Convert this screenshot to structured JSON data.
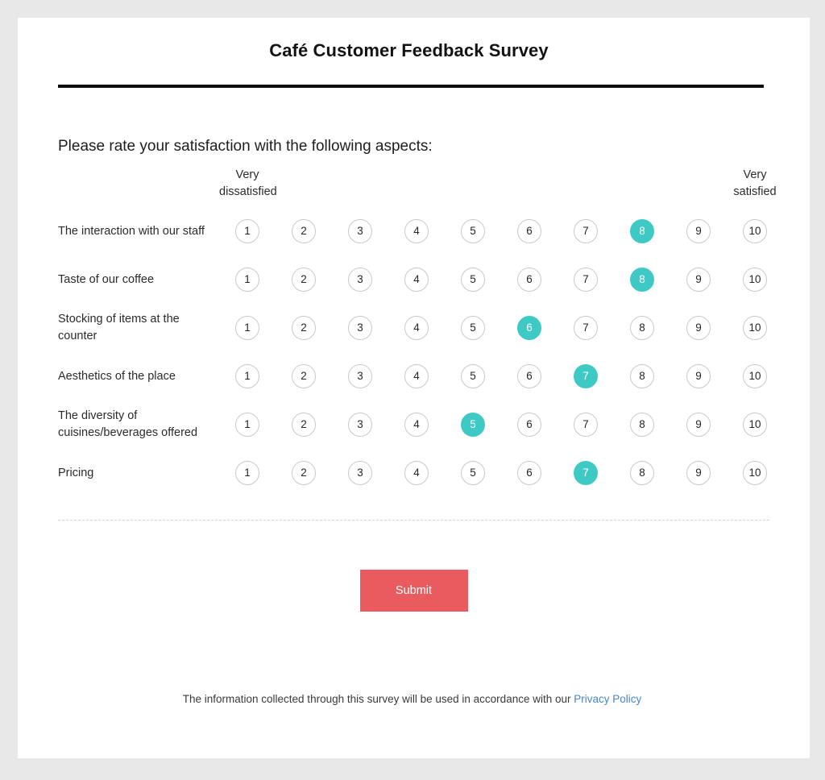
{
  "survey": {
    "title": "Café Customer Feedback Survey",
    "prompt": "Please rate your satisfaction with the following aspects:",
    "anchors": {
      "low_line1": "Very",
      "low_line2": "dissatisfied",
      "high_line1": "Very",
      "high_line2": "satisfied"
    },
    "scale": [
      "1",
      "2",
      "3",
      "4",
      "5",
      "6",
      "7",
      "8",
      "9",
      "10"
    ],
    "rows": [
      {
        "label": "The interaction with our staff",
        "selected": 8
      },
      {
        "label": "Taste of our coffee",
        "selected": 8
      },
      {
        "label": "Stocking of items at the counter",
        "selected": 6
      },
      {
        "label": "Aesthetics of the place",
        "selected": 7
      },
      {
        "label": "The diversity of cuisines/beverages offered",
        "selected": 5
      },
      {
        "label": "Pricing",
        "selected": 7
      }
    ],
    "submit_label": "Submit",
    "footer": {
      "text": "The information collected through this survey will be used in accordance with our ",
      "link_label": "Privacy Policy"
    },
    "colors": {
      "selected": "#3fc9c5",
      "submit": "#ea5b60",
      "link": "#4a86c8",
      "page_background": "#e8e8e8",
      "card_background": "#ffffff",
      "rule": "#0d0d0d"
    }
  }
}
